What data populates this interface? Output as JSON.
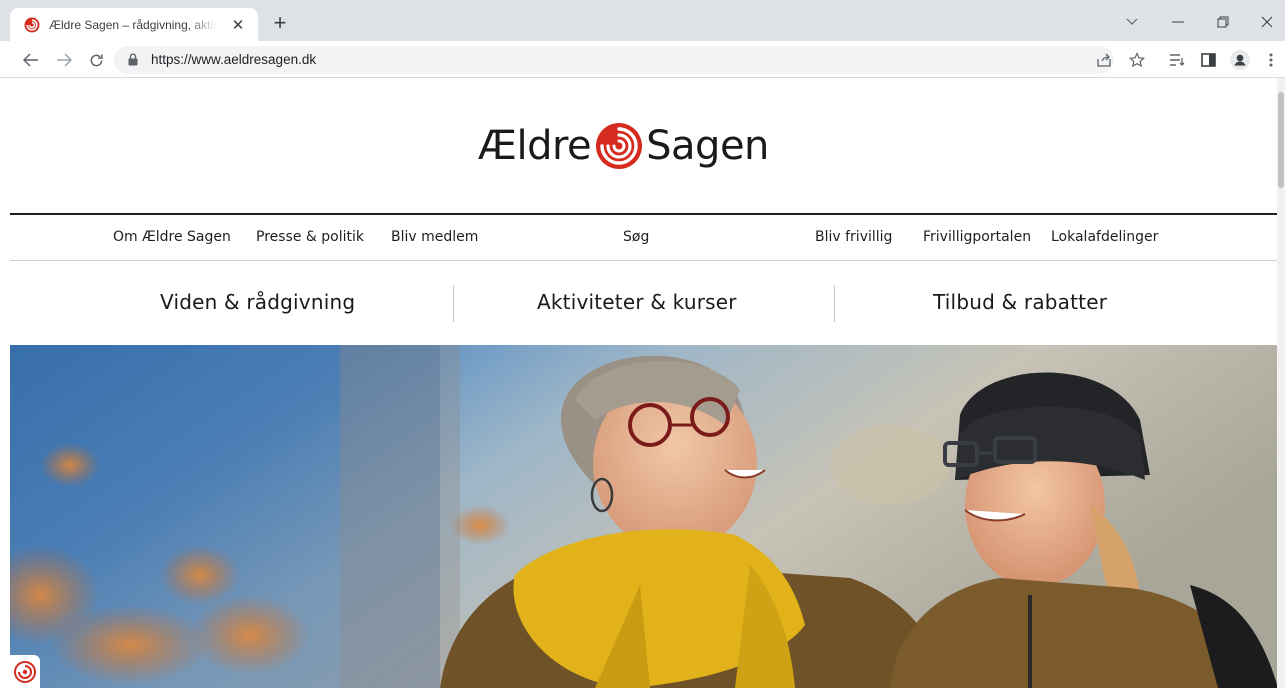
{
  "browser": {
    "tab": {
      "title": "Ældre Sagen – rådgivning, aktiviteter og fællesskab",
      "close_glyph": "✕",
      "favicon": "aeldresagen-spiral-icon"
    },
    "new_tab_glyph": "+",
    "url": "https://www.aeldresagen.dk",
    "accent_color": "#d52b1e"
  },
  "site": {
    "logo": {
      "left": "Ældre",
      "right": "Sagen",
      "mark": "red-spiral-logo"
    },
    "utility_nav": [
      {
        "label": "Om Ældre Sagen"
      },
      {
        "label": "Presse & politik"
      },
      {
        "label": "Bliv medlem"
      },
      {
        "label": "Søg"
      },
      {
        "label": "Bliv frivillig"
      },
      {
        "label": "Frivilligportalen"
      },
      {
        "label": "Lokalafdelinger"
      }
    ],
    "main_nav": [
      {
        "label": "Viden & rådgivning"
      },
      {
        "label": "Aktiviteter & kurser"
      },
      {
        "label": "Tilbud & rabatter"
      }
    ],
    "hero": {
      "subject": "two laughing senior women outdoors in autumn"
    }
  }
}
